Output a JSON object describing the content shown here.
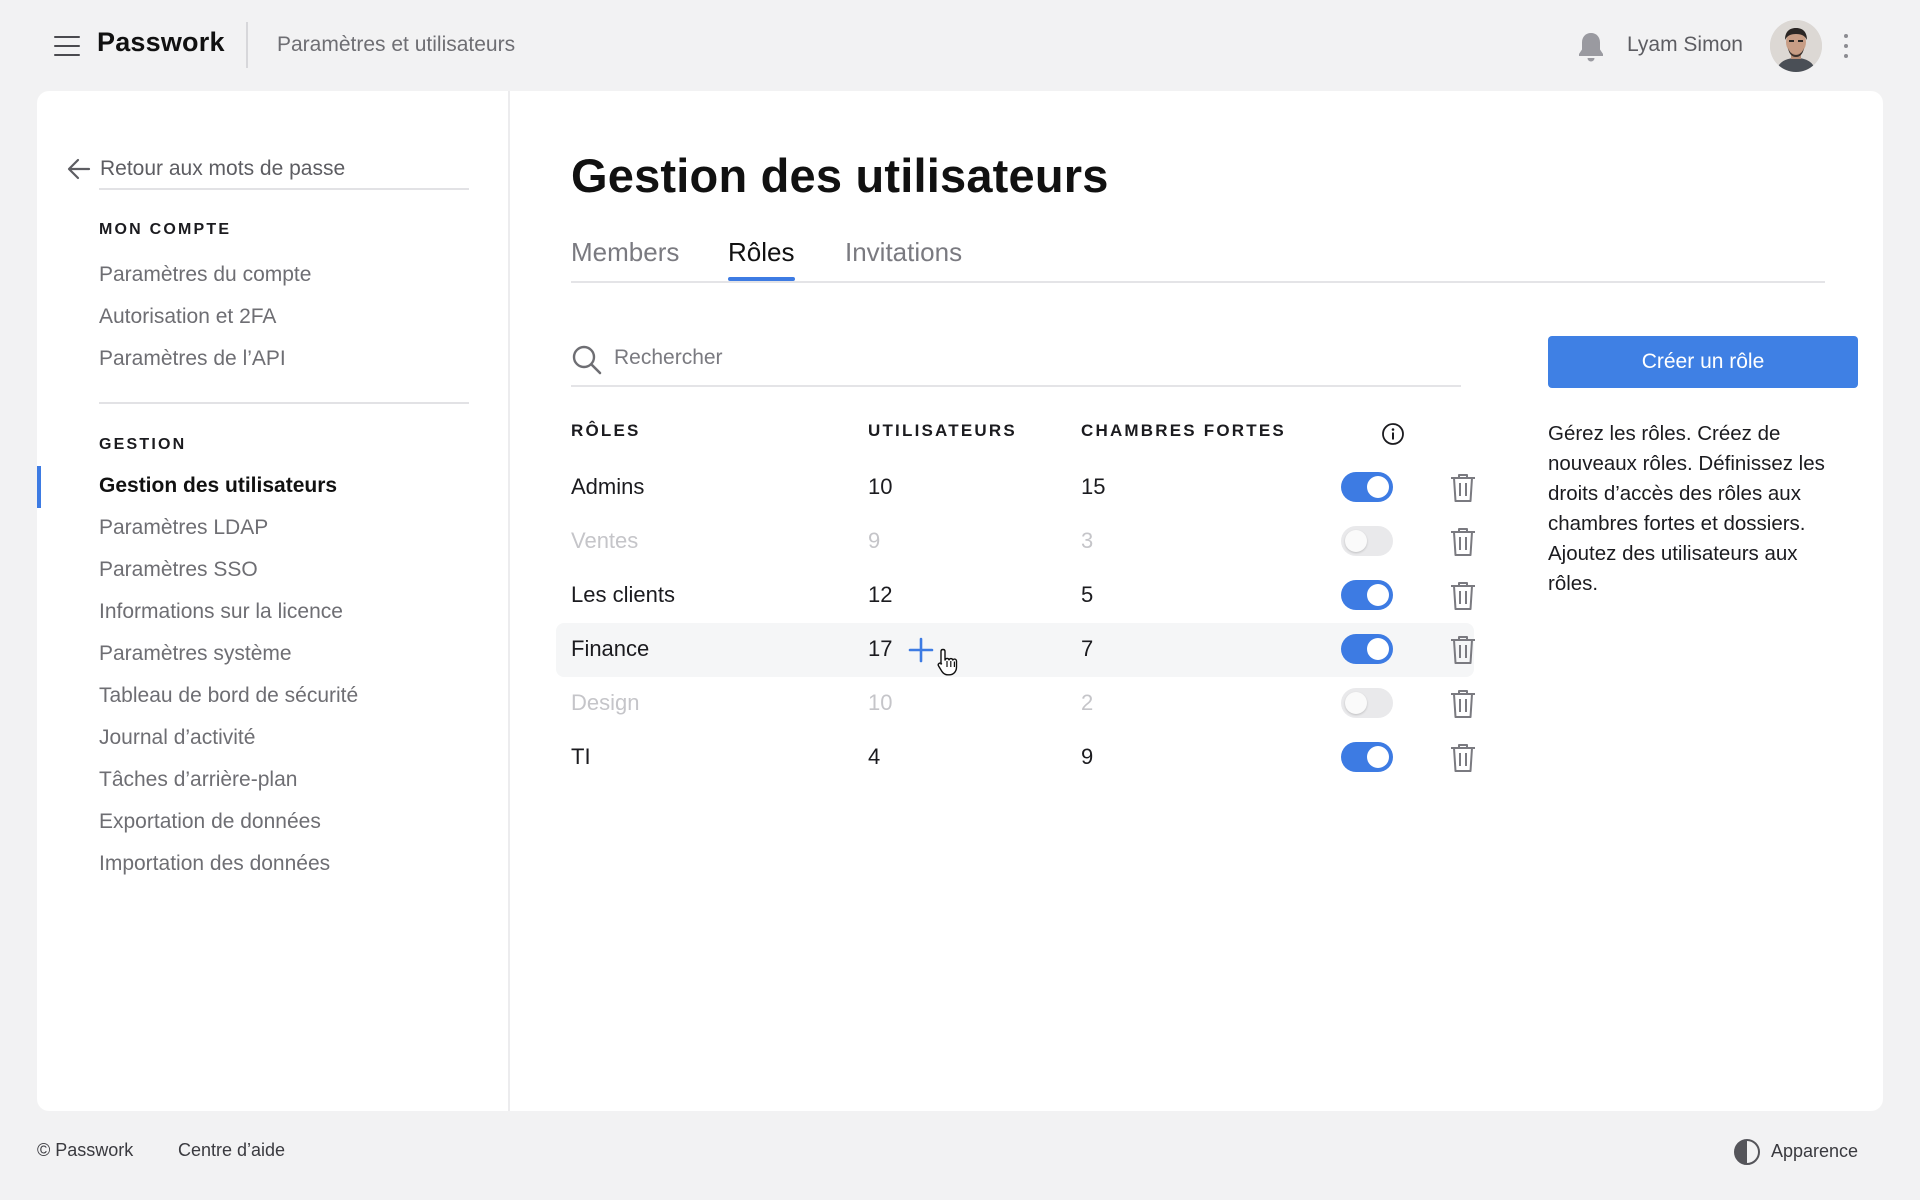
{
  "header": {
    "brand": "Passwork",
    "breadcrumb": "Paramètres et utilisateurs",
    "username": "Lyam Simon"
  },
  "sidebar": {
    "back_label": "Retour aux mots de passe",
    "account_title": "MON COMPTE",
    "account_items": [
      "Paramètres du compte",
      "Autorisation et 2FA",
      "Paramètres de l’API"
    ],
    "management_title": "GESTION",
    "management_items": [
      "Gestion des utilisateurs",
      "Paramètres LDAP",
      "Paramètres SSO",
      "Informations sur la licence",
      "Paramètres système",
      "Tableau de bord de sécurité",
      "Journal d’activité",
      "Tâches d’arrière-plan",
      "Exportation de données",
      "Importation des données"
    ]
  },
  "main": {
    "title": "Gestion des utilisateurs",
    "tabs": [
      "Members",
      "Rôles",
      "Invitations"
    ],
    "active_tab": "Rôles",
    "search_placeholder": "Rechercher",
    "columns": {
      "roles": "RÔLES",
      "users": "UTILISATEURS",
      "vaults": "CHAMBRES FORTES"
    },
    "rows": [
      {
        "name": "Admins",
        "users": "10",
        "vaults": "15",
        "enabled": true
      },
      {
        "name": "Ventes",
        "users": "9",
        "vaults": "3",
        "enabled": false
      },
      {
        "name": "Les clients",
        "users": "12",
        "vaults": "5",
        "enabled": true
      },
      {
        "name": "Finance",
        "users": "17",
        "vaults": "7",
        "enabled": true
      },
      {
        "name": "Design",
        "users": "10",
        "vaults": "2",
        "enabled": false
      },
      {
        "name": "TI",
        "users": "4",
        "vaults": "9",
        "enabled": true
      }
    ],
    "create_button": "Créer un rôle",
    "help_text": "Gérez les rôles. Créez de nouveaux rôles. Définissez les droits d’accès des rôles aux chambres fortes et dossiers. Ajoutez des utilisateurs aux rôles."
  },
  "footer": {
    "copyright": "© Passwork",
    "help_center": "Centre d’aide",
    "appearance": "Apparence"
  },
  "colors": {
    "accent": "#3d7be3",
    "background": "#f2f2f3",
    "toggle_off": "#e9e9eb",
    "muted_text": "#c5c5c9"
  },
  "icons": [
    "menu-icon",
    "bell-icon",
    "kebab-menu-icon",
    "arrow-left-icon",
    "search-icon",
    "info-icon",
    "plus-icon",
    "trash-icon",
    "pointer-cursor-icon",
    "contrast-icon"
  ]
}
